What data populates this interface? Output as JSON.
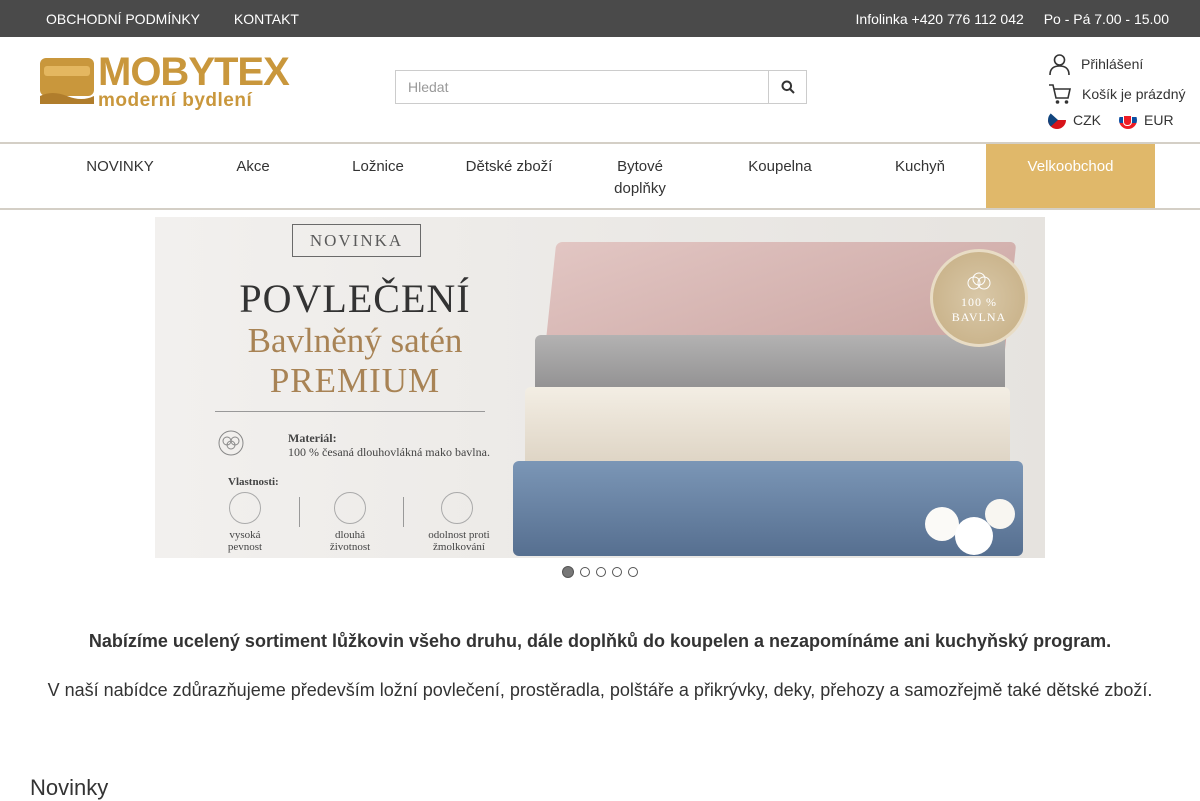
{
  "topbar": {
    "links": [
      "OBCHODNÍ PODMÍNKY",
      "KONTAKT"
    ],
    "infoline": "Infolinka +420 776 112 042",
    "hours": "Po - Pá 7.00 - 15.00"
  },
  "logo": {
    "brand": "MOBYTEX",
    "tagline": "moderní bydlení"
  },
  "search": {
    "placeholder": "Hledat"
  },
  "account": {
    "login": "Přihlášení",
    "cart": "Košík je prázdný",
    "currencies": [
      "CZK",
      "EUR"
    ]
  },
  "nav": {
    "items": [
      "NOVINKY",
      "Akce",
      "Ložnice",
      "Dětské zboží",
      "Bytové doplňky",
      "Koupelna",
      "Kuchyň",
      "Velkoobchod"
    ],
    "active": "Velkoobchod",
    "active_color": "#e0b86a"
  },
  "banner": {
    "badge_top": "NOVINKA",
    "title": "POVLEČENÍ",
    "subtitle": "Bavlněný satén",
    "subtitle2": "PREMIUM",
    "material_label": "Materiál:",
    "material_text": "100 % česaná dlouhovlákná mako bavlna.",
    "properties_label": "Vlastnosti:",
    "properties": [
      "vysoká pevnost",
      "dlouhá životnost",
      "odolnost proti žmolkování"
    ],
    "seal": "100 % BAVLNA",
    "slide_count": 5,
    "active_slide": 1
  },
  "content": {
    "intro_bold": "Nabízíme ucelený sortiment lůžkovin všeho druhu, dále doplňků do koupelen a nezapomínáme ani kuchyňský program.",
    "intro_text": "V naší nabídce zdůrazňujeme především ložní povlečení, prostěradla, polštáře a přikrývky, deky, přehozy a samozřejmě také dětské zboží.",
    "section_title": "Novinky"
  }
}
